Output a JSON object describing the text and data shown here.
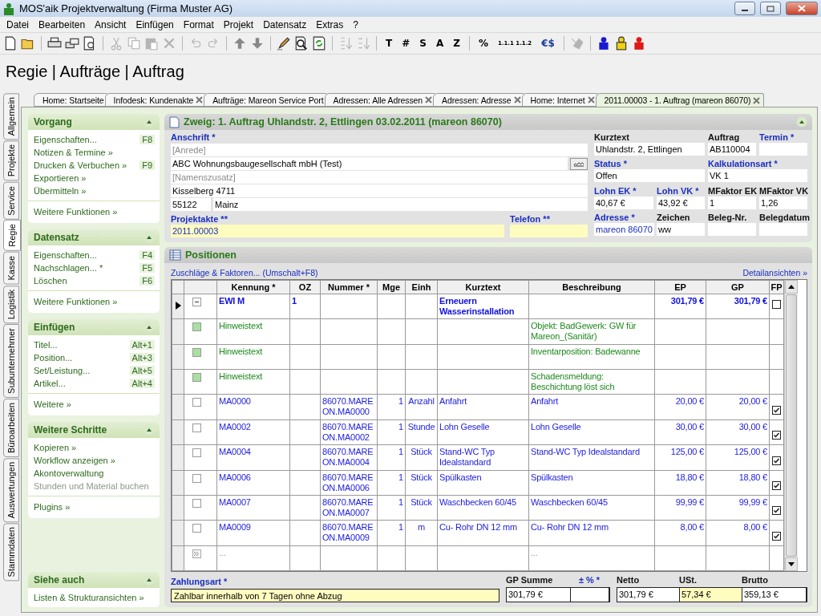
{
  "window": {
    "title": "MOS'aik Projektverwaltung (Firma Muster AG)"
  },
  "menu": [
    "Datei",
    "Bearbeiten",
    "Ansicht",
    "Einfügen",
    "Format",
    "Projekt",
    "Datensatz",
    "Extras",
    "?"
  ],
  "toolbar": [
    {
      "kind": "icon",
      "disabled": false
    },
    {
      "kind": "icon",
      "disabled": false
    },
    {
      "kind": "separator"
    },
    {
      "kind": "icon",
      "disabled": false
    },
    {
      "kind": "icon",
      "disabled": false
    },
    {
      "kind": "icon",
      "disabled": false
    },
    {
      "kind": "separator"
    },
    {
      "kind": "icon",
      "disabled": true
    },
    {
      "kind": "icon",
      "disabled": true
    },
    {
      "kind": "icon",
      "disabled": true
    },
    {
      "kind": "icon",
      "disabled": true
    },
    {
      "kind": "separator"
    },
    {
      "kind": "icon",
      "disabled": true
    },
    {
      "kind": "icon",
      "disabled": true
    },
    {
      "kind": "separator"
    },
    {
      "kind": "icon",
      "disabled": false
    },
    {
      "kind": "icon",
      "disabled": false
    },
    {
      "kind": "separator"
    },
    {
      "kind": "icon",
      "disabled": false
    },
    {
      "kind": "icon",
      "disabled": false
    },
    {
      "kind": "icon",
      "disabled": false
    },
    {
      "kind": "separator"
    },
    {
      "kind": "icon",
      "disabled": true
    },
    {
      "kind": "icon",
      "disabled": true
    },
    {
      "kind": "separator"
    },
    {
      "kind": "text",
      "label": "T"
    },
    {
      "kind": "text",
      "label": "#"
    },
    {
      "kind": "text",
      "label": "S"
    },
    {
      "kind": "text",
      "label": "A"
    },
    {
      "kind": "text",
      "label": "Z"
    },
    {
      "kind": "separator"
    },
    {
      "kind": "text",
      "label": "%"
    },
    {
      "kind": "small",
      "label": "1.1.1 1.1.2"
    },
    {
      "kind": "currency",
      "label": "€$"
    },
    {
      "kind": "separator"
    },
    {
      "kind": "icon",
      "disabled": true
    },
    {
      "kind": "separator"
    },
    {
      "kind": "icon",
      "disabled": false
    },
    {
      "kind": "icon",
      "disabled": false
    },
    {
      "kind": "icon",
      "disabled": false
    }
  ],
  "page_title": "Regie | Aufträge | Auftrag",
  "side_tabs": [
    {
      "label": "Allgemein",
      "selected": false
    },
    {
      "label": "Projekte",
      "selected": false
    },
    {
      "label": "Service",
      "selected": false
    },
    {
      "label": "Regie",
      "selected": true
    },
    {
      "label": "Kasse",
      "selected": false
    },
    {
      "label": "Logistik",
      "selected": false
    },
    {
      "label": "Subunternehmer",
      "selected": false
    },
    {
      "label": "Büroarbeiten",
      "selected": false
    },
    {
      "label": "Auswertungen",
      "selected": false
    },
    {
      "label": "Stammdaten",
      "selected": false
    }
  ],
  "doc_tabs": [
    {
      "label": "Home: Startseite",
      "selected": false,
      "closable": false
    },
    {
      "label": "Infodesk: Kundenakte",
      "selected": false,
      "closable": true
    },
    {
      "label": "Aufträge: Mareon Service Port",
      "selected": false,
      "closable": false
    },
    {
      "label": "Adressen: Alle Adressen",
      "selected": false,
      "closable": true
    },
    {
      "label": "Adressen: Adresse",
      "selected": false,
      "closable": true
    },
    {
      "label": "Home: Internet",
      "selected": false,
      "closable": true
    },
    {
      "label": "2011.00003 - 1. Auftrag (mareon 86070)",
      "selected": true,
      "closable": true
    }
  ],
  "tasks": [
    {
      "title": "Vorgang",
      "expanded": true,
      "items": [
        {
          "label": "Eigenschaften...",
          "shortcut": "F8",
          "disabled": false
        },
        {
          "label": "Notizen & Termine »",
          "disabled": false
        },
        {
          "label": "Drucken & Verbuchen »",
          "shortcut": "F9",
          "disabled": false
        },
        {
          "label": "Exportieren »",
          "disabled": false
        },
        {
          "label": "Übermitteln »",
          "disabled": false
        }
      ],
      "footer": "Weitere Funktionen »"
    },
    {
      "title": "Datensatz",
      "expanded": true,
      "items": [
        {
          "label": "Eigenschaften...",
          "shortcut": "F4",
          "disabled": false
        },
        {
          "label": "Nachschlagen... *",
          "shortcut": "F5",
          "disabled": false
        },
        {
          "label": "Löschen",
          "shortcut": "F6",
          "disabled": false
        }
      ],
      "footer": "Weitere Funktionen »"
    },
    {
      "title": "Einfügen",
      "expanded": true,
      "items": [
        {
          "label": "Titel...",
          "shortcut": "Alt+1",
          "disabled": false
        },
        {
          "label": "Position...",
          "shortcut": "Alt+3",
          "disabled": false
        },
        {
          "label": "Set/Leistung...",
          "shortcut": "Alt+5",
          "disabled": false
        },
        {
          "label": "Artikel...",
          "shortcut": "Alt+4",
          "disabled": false
        }
      ],
      "footer": "Weitere »"
    },
    {
      "title": "Weitere Schritte",
      "expanded": true,
      "items": [
        {
          "label": "Kopieren »",
          "disabled": false
        },
        {
          "label": "Workflow anzeigen »",
          "disabled": false
        },
        {
          "label": "Akontoverwaltung",
          "disabled": false
        },
        {
          "label": "Stunden und Material buchen",
          "disabled": true
        }
      ],
      "footer": "Plugins »"
    },
    {
      "title": "Siehe auch",
      "expanded": true,
      "items": [
        {
          "label": "Listen & Strukturansichten »",
          "disabled": false
        }
      ]
    }
  ],
  "form": {
    "title": "Zweig: 1. Auftrag Uhlandstr. 2, Ettlingen 03.02.2011 (mareon 86070)",
    "expanded": true,
    "address_label": "Anschrift *",
    "address_lines": [
      {
        "placeholder": "[Anrede]"
      },
      {
        "value": "ABC Wohnungsbaugesellschaft mbH (Test)"
      },
      {
        "placeholder": "[Namenszusatz]"
      },
      {
        "value": "Kisselberg 4711"
      }
    ],
    "plz": "55122",
    "ort": "Mainz",
    "bottom": [
      {
        "label": "Projektakte **",
        "value": "2011.00003",
        "required": true,
        "highlighted": true,
        "link": true
      },
      {
        "label": "Telefon **",
        "required": true,
        "highlighted": true,
        "link": false
      }
    ],
    "right_rows": [
      [
        {
          "label": "Kurztext",
          "value": "Uhlandstr. 2, Ettlingen",
          "required": false,
          "link": false
        },
        {
          "label": "Auftrag",
          "value": "AB110004",
          "required": false,
          "link": false
        },
        {
          "label": "Termin *",
          "required": true,
          "link": false
        }
      ],
      [
        {
          "label": "Status *",
          "value": "Offen",
          "required": true,
          "link": false
        },
        {
          "label": "Kalkulationsart *",
          "value": "VK 1",
          "required": true,
          "link": false
        }
      ],
      [
        {
          "label": "Lohn EK *",
          "value": "40,67 €",
          "required": true,
          "link": false
        },
        {
          "label": "Lohn VK *",
          "value": "43,92 €",
          "required": true,
          "link": false
        },
        {
          "label": "MFaktor EK",
          "value": "1",
          "required": false,
          "link": false
        },
        {
          "label": "MFaktor VK",
          "value": "1,26",
          "required": false,
          "link": false
        }
      ],
      [
        {
          "label": "Adresse *",
          "value": "mareon 86070",
          "required": true,
          "link": true
        },
        {
          "label": "Zeichen",
          "value": "ww",
          "required": false,
          "link": false
        },
        {
          "label": "Beleg-Nr.",
          "required": false,
          "link": false
        },
        {
          "label": "Belegdatum",
          "required": false,
          "link": false
        }
      ]
    ]
  },
  "positions": {
    "title": "Positionen",
    "left_link": "Zuschläge & Faktoren... (Umschalt+F8)",
    "right_link": "Detailansichten »",
    "columns": [
      "Kennung *",
      "OZ",
      "Nummer *",
      "Mge",
      "Einh",
      "Kurztext",
      "Beschreibung",
      "EP",
      "GP",
      "FP"
    ],
    "rows": [
      {
        "kind": "group",
        "selected": true,
        "expanded": true,
        "kennung": "EWI  M",
        "oz": "1",
        "kurztext": "Erneuern Wasserinstallation",
        "ep": "301,79 €",
        "gp": "301,79 €",
        "fp": false
      },
      {
        "kind": "note",
        "selected": false,
        "kennung": "Hinweistext",
        "beschreibung": "Objekt: BadGewerk: GW für Mareon_(Sanitär)"
      },
      {
        "kind": "note",
        "selected": false,
        "kennung": "Hinweistext",
        "beschreibung": "Inventarposition: Badewanne"
      },
      {
        "kind": "note",
        "selected": false,
        "kennung": "Hinweistext",
        "beschreibung": "Schadensmeldung: Beschichtung löst sich"
      },
      {
        "kind": "item",
        "selected": false,
        "kennung": "MA0000",
        "nummer": "86070.MAREON.MA0000",
        "mge": "1",
        "einh": "Anzahl",
        "kurztext": "Anfahrt",
        "beschreibung": "Anfahrt",
        "ep": "20,00 €",
        "gp": "20,00 €",
        "fp": true
      },
      {
        "kind": "item",
        "selected": false,
        "kennung": "MA0002",
        "nummer": "86070.MAREON.MA0002",
        "mge": "1",
        "einh": "Stunde",
        "kurztext": "Lohn Geselle",
        "beschreibung": "Lohn Geselle",
        "ep": "30,00 €",
        "gp": "30,00 €",
        "fp": true
      },
      {
        "kind": "item",
        "selected": false,
        "kennung": "MA0004",
        "nummer": "86070.MAREON.MA0004",
        "mge": "1",
        "einh": "Stück",
        "kurztext": "Stand-WC Typ Idealstandard",
        "beschreibung": "Stand-WC Typ Idealstandard",
        "ep": "125,00 €",
        "gp": "125,00 €",
        "fp": true
      },
      {
        "kind": "item",
        "selected": false,
        "kennung": "MA0006",
        "nummer": "86070.MAREON.MA0006",
        "mge": "1",
        "einh": "Stück",
        "kurztext": "Spülkasten",
        "beschreibung": "Spülkasten",
        "ep": "18,80 €",
        "gp": "18,80 €",
        "fp": true
      },
      {
        "kind": "item",
        "selected": false,
        "kennung": "MA0007",
        "nummer": "86070.MAREON.MA0007",
        "mge": "1",
        "einh": "Stück",
        "kurztext": "Waschbecken 60/45",
        "beschreibung": "Waschbecken 60/45",
        "ep": "99,99 €",
        "gp": "99,99 €",
        "fp": true
      },
      {
        "kind": "item",
        "selected": false,
        "kennung": "MA0009",
        "nummer": "86070.MAREON.MA0009",
        "mge": "1",
        "einh": "m",
        "kurztext": "Cu- Rohr DN 12 mm",
        "beschreibung": "Cu- Rohr DN 12 mm",
        "ep": "8,00 €",
        "gp": "8,00 €",
        "fp": true
      },
      {
        "kind": "new",
        "selected": false,
        "kennung": "...",
        "beschreibung": "..."
      }
    ]
  },
  "payment": {
    "label": "Zahlungsart *",
    "value": "Zahlbar innerhalb von 7 Tagen ohne Abzug"
  },
  "totals": [
    [
      {
        "label": "GP Summe",
        "value": "301,79 €",
        "required": false,
        "highlighted": false
      },
      {
        "label": "± % *",
        "required": true,
        "highlighted": false
      }
    ],
    [
      {
        "label": "Netto",
        "value": "301,79 €",
        "required": false,
        "highlighted": false
      },
      {
        "label": "USt.",
        "value": "57,34 €",
        "required": false,
        "highlighted": true
      },
      {
        "label": "Brutto",
        "value": "359,13 €",
        "required": false,
        "highlighted": false
      }
    ]
  ]
}
